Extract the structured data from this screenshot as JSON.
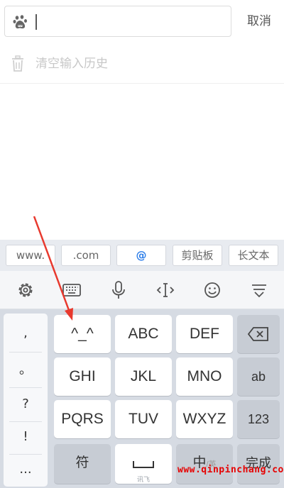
{
  "search": {
    "cancel_label": "取消",
    "icon": "baidu-paw-icon"
  },
  "history": {
    "clear_label": "清空输入历史",
    "icon": "trash-icon"
  },
  "shortcuts": [
    "www.",
    ".com",
    "@",
    "剪贴板",
    "长文本"
  ],
  "toolbar": [
    "settings-gear-icon",
    "keyboard-icon",
    "microphone-icon",
    "cursor-move-icon",
    "emoji-icon",
    "collapse-keyboard-icon"
  ],
  "keyboard": {
    "punctuation": [
      ",",
      "。",
      "?",
      "!",
      "..."
    ],
    "row1": [
      "^_^",
      "ABC",
      "DEF"
    ],
    "row2": [
      "GHI",
      "JKL",
      "MNO"
    ],
    "row3": [
      "PQRS",
      "TUV",
      "WXYZ"
    ],
    "backspace_icon": "backspace-icon",
    "ab_label": "ab",
    "num_label": "123",
    "symbol_label": "符",
    "space_hint": "讯飞",
    "lang_label": "中",
    "lang_alt": "/英",
    "done_label": "完成"
  },
  "watermark": "www.qinpinchang.com",
  "colors": {
    "accent": "#2b7de9",
    "arrow": "#e8392e",
    "keyboard_bg": "#d6dbe3"
  }
}
